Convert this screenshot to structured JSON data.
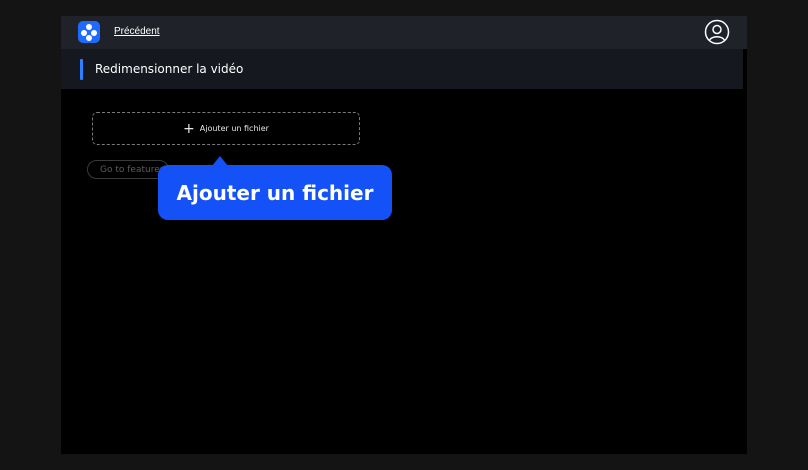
{
  "topbar": {
    "back_label": "Précédent",
    "logo_icon": "app-logo-icon",
    "avatar_icon": "user-account-icon"
  },
  "section": {
    "title": "Redimensionner la vidéo"
  },
  "dropzone": {
    "plus_icon": "+",
    "label": "Ajouter un fichier"
  },
  "feature_button": {
    "label": "Go to features"
  },
  "tooltip": {
    "text": "Ajouter un fichier"
  },
  "colors": {
    "accent": "#1452f7",
    "header_accent": "#2f7fff",
    "topbar_bg": "#1f2229",
    "panel_bg": "#000000"
  }
}
